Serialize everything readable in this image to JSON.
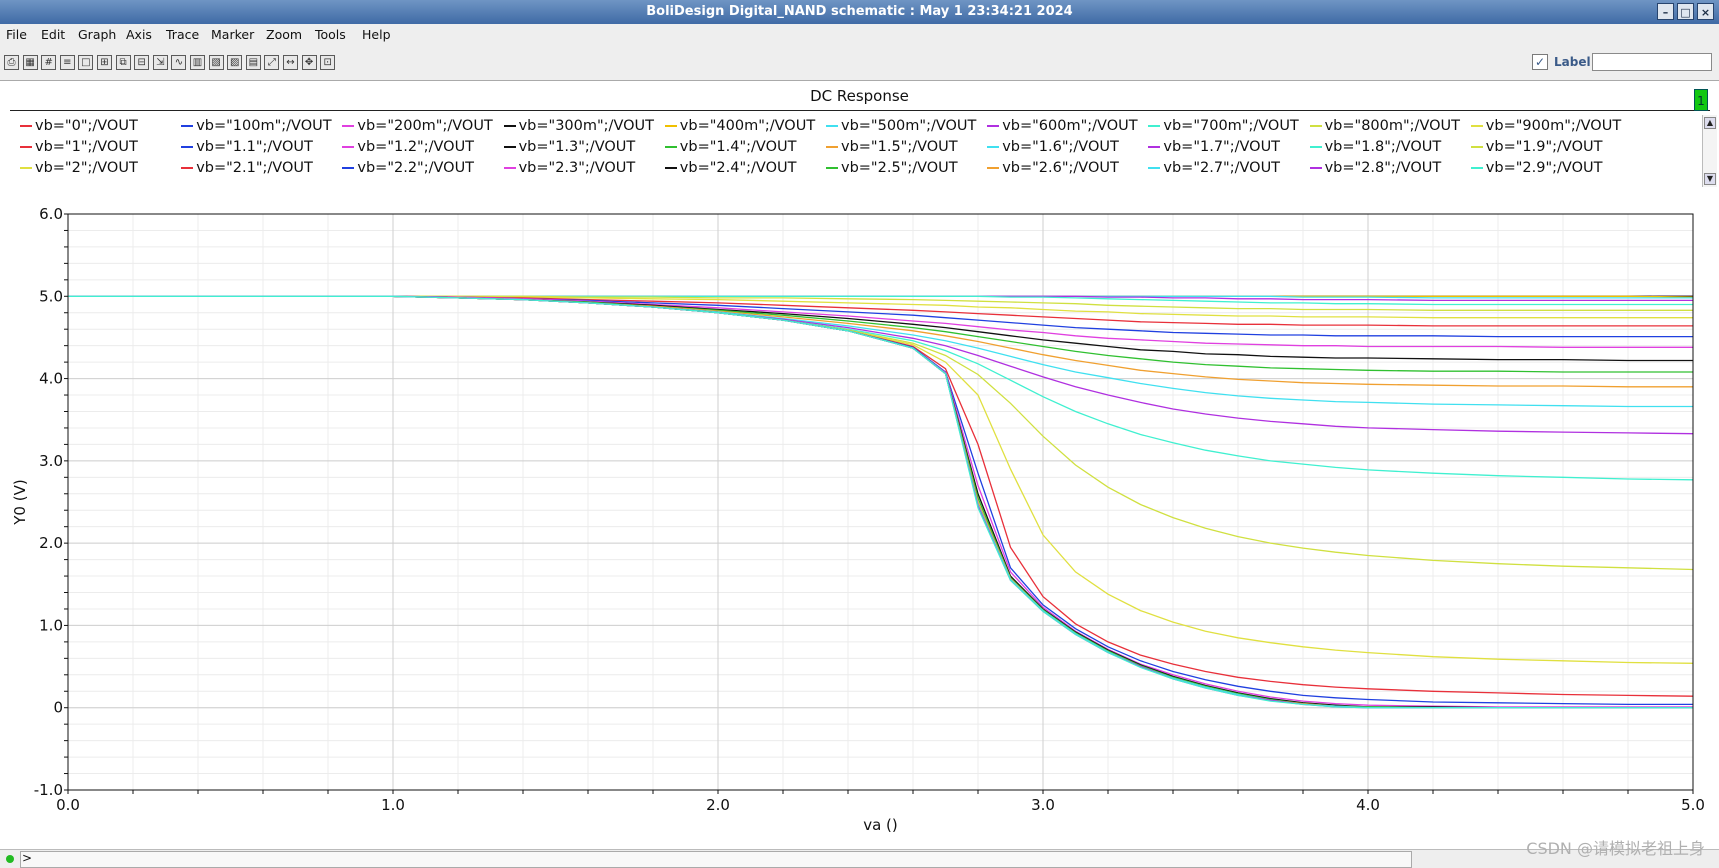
{
  "window": {
    "title": "BoliDesign Digital_NAND schematic : May  1 23:34:21 2024",
    "min_glyph": "–",
    "max_glyph": "□",
    "close_glyph": "×"
  },
  "menu": [
    "File",
    "Edit",
    "Graph",
    "Axis",
    "Trace",
    "Marker",
    "Zoom",
    "Tools",
    "Help"
  ],
  "toolbar": {
    "icons": [
      "print-icon",
      "print-preview-icon",
      "grid-icon",
      "list-icon",
      "blank-icon",
      "split-icon",
      "copy-icon",
      "layout-icon",
      "export-icon",
      "curve-icon",
      "strip-icon",
      "hatch-icon",
      "hatch2-icon",
      "calc-icon",
      "zoom-fit-icon",
      "zoom-x-icon",
      "pan-icon",
      "zoom-box-icon"
    ],
    "label_text": "Label",
    "label_check": "✓",
    "label_value": ""
  },
  "graph_number": "1",
  "status": {
    "prompt": ">"
  },
  "watermark": "CSDN @请模拟老祖上身",
  "chart_data": {
    "type": "line",
    "title": "DC Response",
    "xlabel": "va ()",
    "ylabel": "Y0 (V)",
    "xlim": [
      0,
      5
    ],
    "ylim": [
      -1,
      6
    ],
    "xticks": [
      "0.0",
      "1.0",
      "2.0",
      "3.0",
      "4.0",
      "5.0"
    ],
    "yticks": [
      "6.0",
      "5.0",
      "4.0",
      "3.0",
      "2.0",
      "1.0",
      "0",
      "-1.0"
    ],
    "grid": true,
    "legend_position": "top",
    "x": [
      0,
      1.0,
      1.2,
      1.4,
      1.6,
      1.8,
      2.0,
      2.2,
      2.4,
      2.6,
      2.7,
      2.8,
      2.9,
      3.0,
      3.1,
      3.2,
      3.3,
      3.4,
      3.5,
      3.6,
      3.7,
      3.8,
      3.9,
      4.0,
      4.2,
      4.4,
      4.6,
      4.8,
      5.0
    ],
    "series": [
      {
        "name": "vb=\"0\";/VOUT",
        "color": "#e8303a",
        "values": [
          5,
          5,
          5,
          5,
          5,
          5,
          5,
          5,
          5,
          5,
          5,
          5,
          5,
          5,
          5,
          5,
          5,
          5,
          5,
          5,
          5,
          5,
          5,
          5,
          5,
          5,
          5,
          5,
          5
        ]
      },
      {
        "name": "vb=\"100m\";/VOUT",
        "color": "#2040e0",
        "values": [
          5,
          5,
          5,
          5,
          5,
          5,
          5,
          5,
          5,
          5,
          5,
          5,
          5,
          5,
          5,
          5,
          5,
          5,
          5,
          5,
          5,
          5,
          5,
          5,
          5,
          5,
          5,
          5,
          5
        ]
      },
      {
        "name": "vb=\"200m\";/VOUT",
        "color": "#e040e0",
        "values": [
          5,
          5,
          5,
          5,
          5,
          5,
          5,
          5,
          5,
          5,
          5,
          5,
          5,
          5,
          5,
          5,
          5,
          5,
          5,
          5,
          5,
          5,
          5,
          5,
          5,
          5,
          5,
          5,
          5
        ]
      },
      {
        "name": "vb=\"300m\";/VOUT",
        "color": "#111111",
        "values": [
          5,
          5,
          5,
          5,
          5,
          5,
          5,
          5,
          5,
          5,
          5,
          5,
          5,
          5,
          5,
          5,
          5,
          5,
          5,
          5,
          5,
          5,
          5,
          5,
          5,
          5,
          5,
          5,
          5
        ]
      },
      {
        "name": "vb=\"400m\";/VOUT",
        "color": "#f0c000",
        "values": [
          5,
          5,
          5,
          5,
          5,
          5,
          5,
          5,
          5,
          5,
          5,
          5,
          5,
          5,
          5,
          5,
          5,
          5,
          5,
          5,
          5,
          5,
          5,
          5,
          5,
          5,
          5,
          5,
          4.99
        ]
      },
      {
        "name": "vb=\"500m\";/VOUT",
        "color": "#40e0f0",
        "values": [
          5,
          5,
          5,
          5,
          5,
          5,
          5,
          5,
          5,
          5,
          5,
          5,
          5,
          5,
          5,
          5,
          5,
          5,
          5,
          5,
          5,
          4.99,
          4.99,
          4.99,
          4.98,
          4.98,
          4.98,
          4.98,
          4.98
        ]
      },
      {
        "name": "vb=\"600m\";/VOUT",
        "color": "#b030e0",
        "values": [
          5,
          5,
          5,
          5,
          5,
          5,
          5,
          5,
          5,
          5,
          5,
          5,
          5,
          5,
          5,
          4.99,
          4.99,
          4.98,
          4.98,
          4.97,
          4.97,
          4.96,
          4.96,
          4.96,
          4.95,
          4.95,
          4.95,
          4.95,
          4.95
        ]
      },
      {
        "name": "vb=\"700m\";/VOUT",
        "color": "#40f0d0",
        "values": [
          5,
          5,
          5,
          5,
          5,
          5,
          5,
          5,
          5,
          5,
          5,
          5,
          4.99,
          4.99,
          4.98,
          4.97,
          4.96,
          4.95,
          4.94,
          4.93,
          4.92,
          4.92,
          4.91,
          4.91,
          4.9,
          4.9,
          4.9,
          4.9,
          4.9
        ]
      },
      {
        "name": "vb=\"800m\";/VOUT",
        "color": "#d0e040",
        "values": [
          5,
          5,
          5,
          5,
          4.99,
          4.99,
          4.98,
          4.98,
          4.97,
          4.96,
          4.95,
          4.94,
          4.93,
          4.92,
          4.91,
          4.89,
          4.88,
          4.87,
          4.86,
          4.85,
          4.85,
          4.84,
          4.84,
          4.84,
          4.83,
          4.83,
          4.83,
          4.83,
          4.83
        ]
      },
      {
        "name": "vb=\"900m\";/VOUT",
        "color": "#e0e040",
        "values": [
          5,
          5,
          5,
          4.99,
          4.98,
          4.97,
          4.96,
          4.94,
          4.92,
          4.9,
          4.89,
          4.87,
          4.86,
          4.84,
          4.82,
          4.81,
          4.79,
          4.78,
          4.77,
          4.76,
          4.76,
          4.75,
          4.75,
          4.75,
          4.74,
          4.74,
          4.74,
          4.74,
          4.74
        ]
      },
      {
        "name": "vb=\"1\";/VOUT",
        "color": "#e8303a",
        "values": [
          5,
          5,
          4.99,
          4.98,
          4.96,
          4.94,
          4.92,
          4.89,
          4.86,
          4.83,
          4.81,
          4.79,
          4.77,
          4.75,
          4.73,
          4.71,
          4.69,
          4.68,
          4.67,
          4.66,
          4.66,
          4.65,
          4.65,
          4.65,
          4.64,
          4.64,
          4.64,
          4.64,
          4.64
        ]
      },
      {
        "name": "vb=\"1.1\";/VOUT",
        "color": "#2040e0",
        "values": [
          5,
          5,
          4.99,
          4.97,
          4.95,
          4.92,
          4.89,
          4.85,
          4.81,
          4.77,
          4.74,
          4.71,
          4.68,
          4.65,
          4.62,
          4.6,
          4.58,
          4.56,
          4.55,
          4.54,
          4.53,
          4.53,
          4.52,
          4.52,
          4.52,
          4.51,
          4.51,
          4.51,
          4.51
        ]
      },
      {
        "name": "vb=\"1.2\";/VOUT",
        "color": "#e040e0",
        "values": [
          5,
          5,
          4.99,
          4.97,
          4.94,
          4.9,
          4.86,
          4.81,
          4.76,
          4.7,
          4.67,
          4.63,
          4.59,
          4.56,
          4.52,
          4.49,
          4.47,
          4.45,
          4.43,
          4.42,
          4.41,
          4.4,
          4.4,
          4.39,
          4.39,
          4.39,
          4.38,
          4.38,
          4.38
        ]
      },
      {
        "name": "vb=\"1.3\";/VOUT",
        "color": "#111111",
        "values": [
          5,
          5,
          4.98,
          4.96,
          4.93,
          4.89,
          4.84,
          4.79,
          4.73,
          4.66,
          4.62,
          4.57,
          4.52,
          4.47,
          4.43,
          4.39,
          4.35,
          4.33,
          4.3,
          4.29,
          4.27,
          4.26,
          4.25,
          4.25,
          4.24,
          4.23,
          4.23,
          4.22,
          4.22
        ]
      },
      {
        "name": "vb=\"1.4\";/VOUT",
        "color": "#30c030",
        "values": [
          5,
          5,
          4.98,
          4.96,
          4.93,
          4.88,
          4.83,
          4.77,
          4.7,
          4.62,
          4.57,
          4.51,
          4.45,
          4.39,
          4.33,
          4.28,
          4.24,
          4.2,
          4.17,
          4.15,
          4.13,
          4.12,
          4.11,
          4.1,
          4.09,
          4.09,
          4.08,
          4.08,
          4.08
        ]
      },
      {
        "name": "vb=\"1.5\";/VOUT",
        "color": "#f0a030",
        "values": [
          5,
          5,
          4.98,
          4.96,
          4.92,
          4.88,
          4.82,
          4.75,
          4.67,
          4.58,
          4.52,
          4.45,
          4.37,
          4.29,
          4.22,
          4.16,
          4.1,
          4.06,
          4.02,
          3.99,
          3.97,
          3.95,
          3.94,
          3.93,
          3.92,
          3.91,
          3.91,
          3.9,
          3.9
        ]
      },
      {
        "name": "vb=\"1.6\";/VOUT",
        "color": "#40e0f0",
        "values": [
          5,
          5,
          4.98,
          4.96,
          4.92,
          4.87,
          4.81,
          4.73,
          4.64,
          4.53,
          4.46,
          4.37,
          4.27,
          4.17,
          4.08,
          4.01,
          3.94,
          3.88,
          3.83,
          3.79,
          3.76,
          3.74,
          3.72,
          3.71,
          3.69,
          3.68,
          3.67,
          3.66,
          3.66
        ]
      },
      {
        "name": "vb=\"1.7\";/VOUT",
        "color": "#b030e0",
        "values": [
          5,
          5,
          4.98,
          4.96,
          4.92,
          4.87,
          4.8,
          4.72,
          4.62,
          4.49,
          4.4,
          4.28,
          4.15,
          4.02,
          3.9,
          3.8,
          3.71,
          3.63,
          3.57,
          3.52,
          3.48,
          3.45,
          3.42,
          3.4,
          3.38,
          3.36,
          3.35,
          3.34,
          3.33
        ]
      },
      {
        "name": "vb=\"1.8\";/VOUT",
        "color": "#40f0d0",
        "values": [
          5,
          5,
          4.98,
          4.96,
          4.92,
          4.87,
          4.8,
          4.71,
          4.6,
          4.46,
          4.34,
          4.18,
          3.98,
          3.78,
          3.6,
          3.45,
          3.32,
          3.22,
          3.13,
          3.06,
          3.0,
          2.96,
          2.92,
          2.89,
          2.85,
          2.82,
          2.8,
          2.78,
          2.77
        ]
      },
      {
        "name": "vb=\"1.9\";/VOUT",
        "color": "#d0e040",
        "values": [
          5,
          5,
          4.98,
          4.96,
          4.92,
          4.87,
          4.8,
          4.71,
          4.59,
          4.43,
          4.28,
          4.05,
          3.7,
          3.3,
          2.95,
          2.68,
          2.47,
          2.31,
          2.18,
          2.08,
          2.0,
          1.94,
          1.89,
          1.85,
          1.79,
          1.75,
          1.72,
          1.7,
          1.68
        ]
      },
      {
        "name": "vb=\"2\";/VOUT",
        "color": "#e0e040",
        "values": [
          5,
          5,
          4.98,
          4.96,
          4.92,
          4.87,
          4.8,
          4.71,
          4.58,
          4.41,
          4.2,
          3.8,
          2.9,
          2.1,
          1.65,
          1.38,
          1.18,
          1.04,
          0.93,
          0.85,
          0.79,
          0.74,
          0.7,
          0.67,
          0.62,
          0.59,
          0.57,
          0.55,
          0.54
        ]
      },
      {
        "name": "vb=\"2.1\";/VOUT",
        "color": "#e8303a",
        "values": [
          5,
          5,
          4.98,
          4.96,
          4.92,
          4.87,
          4.8,
          4.71,
          4.58,
          4.39,
          4.12,
          3.2,
          1.95,
          1.35,
          1.02,
          0.8,
          0.64,
          0.53,
          0.44,
          0.37,
          0.32,
          0.28,
          0.25,
          0.23,
          0.2,
          0.18,
          0.16,
          0.15,
          0.14
        ]
      },
      {
        "name": "vb=\"2.2\";/VOUT",
        "color": "#2040e0",
        "values": [
          5,
          5,
          4.98,
          4.96,
          4.92,
          4.87,
          4.8,
          4.71,
          4.58,
          4.38,
          4.08,
          2.85,
          1.7,
          1.25,
          0.96,
          0.74,
          0.57,
          0.44,
          0.34,
          0.26,
          0.2,
          0.15,
          0.12,
          0.1,
          0.07,
          0.06,
          0.05,
          0.04,
          0.04
        ]
      },
      {
        "name": "vb=\"2.3\";/VOUT",
        "color": "#e040e0",
        "values": [
          5,
          5,
          4.98,
          4.96,
          4.92,
          4.87,
          4.8,
          4.71,
          4.58,
          4.37,
          4.07,
          2.7,
          1.65,
          1.22,
          0.93,
          0.71,
          0.53,
          0.4,
          0.29,
          0.2,
          0.13,
          0.08,
          0.05,
          0.03,
          0.02,
          0.01,
          0.01,
          0.01,
          0.01
        ]
      },
      {
        "name": "vb=\"2.4\";/VOUT",
        "color": "#111111",
        "values": [
          5,
          5,
          4.98,
          4.96,
          4.92,
          4.87,
          4.8,
          4.71,
          4.58,
          4.37,
          4.06,
          2.6,
          1.6,
          1.2,
          0.92,
          0.7,
          0.52,
          0.38,
          0.27,
          0.18,
          0.11,
          0.06,
          0.03,
          0.01,
          0.01,
          0,
          0,
          0,
          0
        ]
      },
      {
        "name": "vb=\"2.5\";/VOUT",
        "color": "#30c030",
        "values": [
          5,
          5,
          4.98,
          4.96,
          4.92,
          4.87,
          4.8,
          4.71,
          4.58,
          4.37,
          4.06,
          2.55,
          1.58,
          1.19,
          0.91,
          0.69,
          0.51,
          0.37,
          0.26,
          0.17,
          0.1,
          0.05,
          0.02,
          0.01,
          0,
          0,
          0,
          0,
          0
        ]
      },
      {
        "name": "vb=\"2.6\";/VOUT",
        "color": "#f0a030",
        "values": [
          5,
          5,
          4.98,
          4.96,
          4.92,
          4.87,
          4.8,
          4.71,
          4.58,
          4.37,
          4.06,
          2.5,
          1.57,
          1.18,
          0.9,
          0.68,
          0.5,
          0.36,
          0.25,
          0.16,
          0.09,
          0.05,
          0.02,
          0,
          0,
          0,
          0,
          0,
          0
        ]
      },
      {
        "name": "vb=\"2.7\";/VOUT",
        "color": "#40e0f0",
        "values": [
          5,
          5,
          4.98,
          4.96,
          4.92,
          4.87,
          4.8,
          4.71,
          4.58,
          4.37,
          4.06,
          2.47,
          1.56,
          1.18,
          0.9,
          0.68,
          0.5,
          0.36,
          0.25,
          0.16,
          0.09,
          0.04,
          0.02,
          0,
          0,
          0,
          0,
          0,
          0
        ]
      },
      {
        "name": "vb=\"2.8\";/VOUT",
        "color": "#b030e0",
        "values": [
          5,
          5,
          4.98,
          4.96,
          4.92,
          4.87,
          4.8,
          4.71,
          4.58,
          4.37,
          4.06,
          2.45,
          1.55,
          1.17,
          0.89,
          0.67,
          0.5,
          0.35,
          0.24,
          0.15,
          0.09,
          0.04,
          0.01,
          0,
          0,
          0,
          0,
          0,
          0
        ]
      },
      {
        "name": "vb=\"2.9\";/VOUT",
        "color": "#40f0d0",
        "values": [
          5,
          5,
          4.98,
          4.96,
          4.92,
          4.87,
          4.8,
          4.71,
          4.58,
          4.37,
          4.06,
          2.43,
          1.55,
          1.17,
          0.89,
          0.67,
          0.49,
          0.35,
          0.24,
          0.15,
          0.08,
          0.04,
          0.01,
          0,
          0,
          0,
          0,
          0,
          0
        ]
      }
    ]
  }
}
